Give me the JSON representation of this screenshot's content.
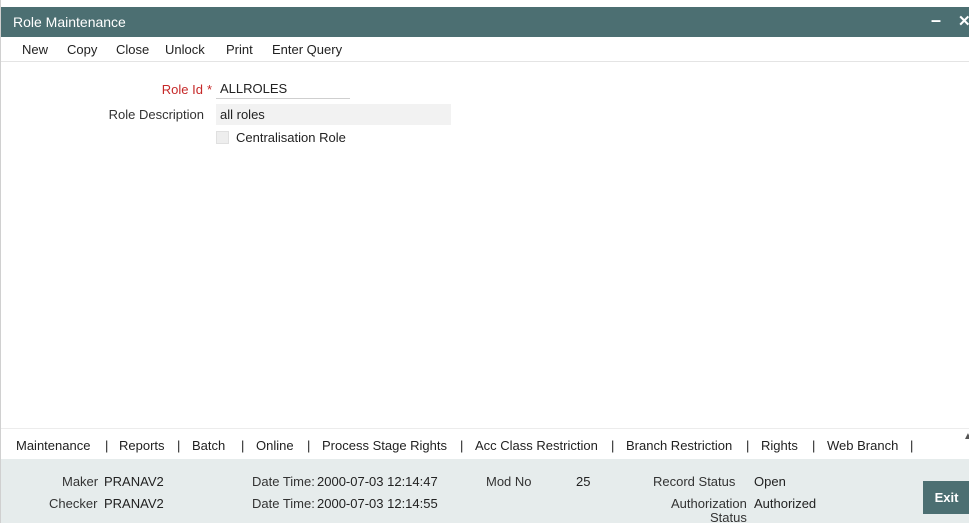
{
  "window": {
    "title": "Role Maintenance",
    "minimize_glyph": "–",
    "close_glyph": "✕"
  },
  "toolbar": {
    "new": "New",
    "copy": "Copy",
    "close": "Close",
    "unlock": "Unlock",
    "print": "Print",
    "enter_query": "Enter Query"
  },
  "form": {
    "role_id_label": "Role Id",
    "required_mark": "*",
    "role_id_value": "ALLROLES",
    "role_description_label": "Role Description",
    "role_description_value": "all roles",
    "centralisation_label": "Centralisation Role",
    "centralisation_checked": false
  },
  "bottom_nav": {
    "items": [
      "Maintenance",
      "Reports",
      "Batch",
      "Online",
      "Process Stage Rights",
      "Acc Class Restriction",
      "Branch Restriction",
      "Rights",
      "Web Branch"
    ],
    "separator": "|"
  },
  "footer": {
    "maker_label": "Maker",
    "maker_value": "PRANAV2",
    "checker_label": "Checker",
    "checker_value": "PRANAV2",
    "maker_datetime_label": "Date Time:",
    "maker_datetime_value": "2000-07-03 12:14:47",
    "checker_datetime_label": "Date Time:",
    "checker_datetime_value": "2000-07-03 12:14:55",
    "mod_no_label": "Mod No",
    "mod_no_value": "25",
    "record_status_label": "Record Status",
    "record_status_value": "Open",
    "auth_status_label_1": "Authorization",
    "auth_status_label_2": "Status",
    "auth_status_value": "Authorized",
    "exit_label": "Exit"
  },
  "colors": {
    "titlebar": "#4c6f72",
    "footer_bg": "#e6ecec",
    "required": "#c62828"
  }
}
